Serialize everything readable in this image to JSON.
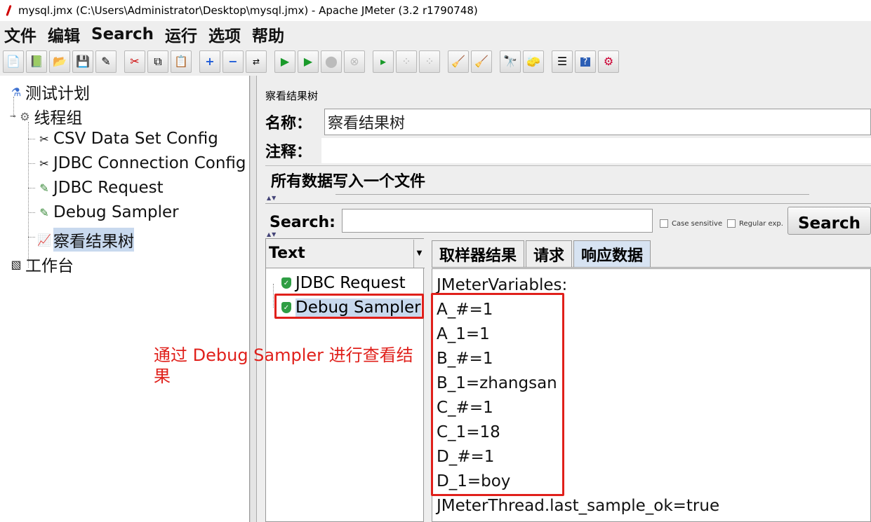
{
  "window": {
    "title": "mysql.jmx (C:\\Users\\Administrator\\Desktop\\mysql.jmx) - Apache JMeter (3.2 r1790748)"
  },
  "menu": [
    "文件",
    "编辑",
    "Search",
    "运行",
    "选项",
    "帮助"
  ],
  "toolbar": {
    "groups": [
      [
        "new-icon",
        "templates-icon",
        "open-icon",
        "save-icon",
        "save-as-icon"
      ],
      [
        "cut-icon",
        "copy-icon",
        "paste-icon"
      ],
      [
        "expand-icon",
        "collapse-icon",
        "toggle-icon"
      ],
      [
        "start-icon",
        "start-no-pause-icon",
        "stop-icon",
        "shutdown-icon"
      ],
      [
        "remote-start-icon",
        "remote-stop-icon",
        "remote-shutdown-icon"
      ],
      [
        "clear-icon",
        "clear-all-icon"
      ],
      [
        "search-icon",
        "reset-search-icon"
      ],
      [
        "function-helper-icon",
        "help-icon",
        "log-icon"
      ]
    ]
  },
  "tree": {
    "items": [
      {
        "label": "测试计划",
        "icon": "test-plan-icon"
      },
      {
        "label": "线程组",
        "icon": "thread-group-icon"
      },
      {
        "label": "CSV Data Set Config",
        "icon": "config-icon"
      },
      {
        "label": "JDBC Connection Config",
        "icon": "config-icon"
      },
      {
        "label": "JDBC Request",
        "icon": "sampler-icon"
      },
      {
        "label": "Debug Sampler",
        "icon": "sampler-icon"
      },
      {
        "label": "察看结果树",
        "icon": "listener-icon",
        "selected": true
      },
      {
        "label": "工作台",
        "icon": "workbench-icon"
      }
    ]
  },
  "panel": {
    "title": "察看结果树",
    "name_label": "名称：",
    "name_value": "察看结果树",
    "comment_label": "注释：",
    "comment_value": "",
    "file_section": "所有数据写入一个文件"
  },
  "search": {
    "label": "Search:",
    "value": "",
    "case_sensitive": "Case sensitive",
    "regular_exp": "Regular exp.",
    "button": "Search"
  },
  "results": {
    "renderer": "Text",
    "samples": [
      {
        "label": "JDBC Request",
        "status": "success"
      },
      {
        "label": "Debug Sampler",
        "status": "success",
        "selected": true
      }
    ]
  },
  "tabs": [
    "取样器结果",
    "请求",
    "响应数据"
  ],
  "active_tab": "响应数据",
  "response": {
    "lines": [
      "JMeterVariables:",
      "A_#=1",
      "A_1=1",
      "B_#=1",
      "B_1=zhangsan",
      "C_#=1",
      "C_1=18",
      "D_#=1",
      "D_1=boy",
      "JMeterThread.last_sample_ok=true"
    ]
  },
  "annotation": {
    "text": "通过 Debug Sampler 进行查看结果"
  },
  "colors": {
    "highlight_red": "#e0201b",
    "selection": "#c8d9ee",
    "success_green": "#2f9e44"
  }
}
